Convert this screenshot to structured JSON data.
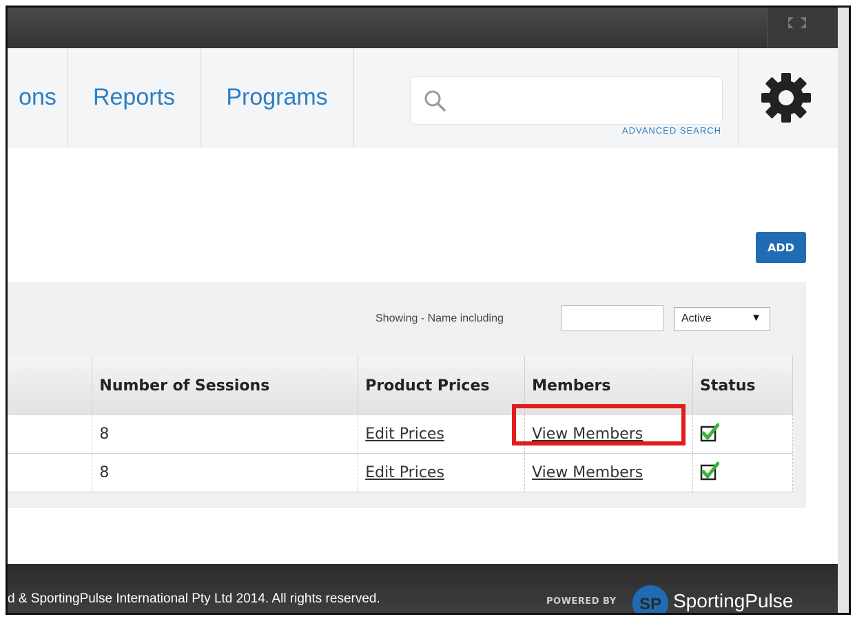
{
  "nav": {
    "items": [
      {
        "label": "ons"
      },
      {
        "label": "Reports"
      },
      {
        "label": "Programs"
      }
    ]
  },
  "search": {
    "placeholder": "",
    "advanced_label": "ADVANCED SEARCH",
    "icon": "search-icon"
  },
  "settings": {
    "icon": "gear-icon"
  },
  "toolbar": {
    "add_label": "ADD",
    "add_color": "#1f6cb5"
  },
  "filter": {
    "label": "Showing - Name including",
    "name_value": "",
    "status_selected": "Active",
    "status_arrow": "▼"
  },
  "table": {
    "headers": [
      "Number of Sessions",
      "Product Prices",
      "Members",
      "Status"
    ],
    "rows": [
      {
        "sessions": "8",
        "prices": "Edit Prices",
        "members": "View Members",
        "status_icon": "checkbox-checked-icon"
      },
      {
        "sessions": "8",
        "prices": "Edit Prices",
        "members": "View Members",
        "status_icon": "checkbox-checked-icon"
      }
    ]
  },
  "footer": {
    "copyright": "d & SportingPulse International Pty Ltd  2014.  All rights reserved.",
    "powered_by": "POWERED BY",
    "brand": "SportingPulse",
    "logo_text": "SP"
  },
  "colors": {
    "link_blue": "#2b7fc4",
    "highlight_red": "#e21b1b",
    "check_green": "#3db33d"
  }
}
